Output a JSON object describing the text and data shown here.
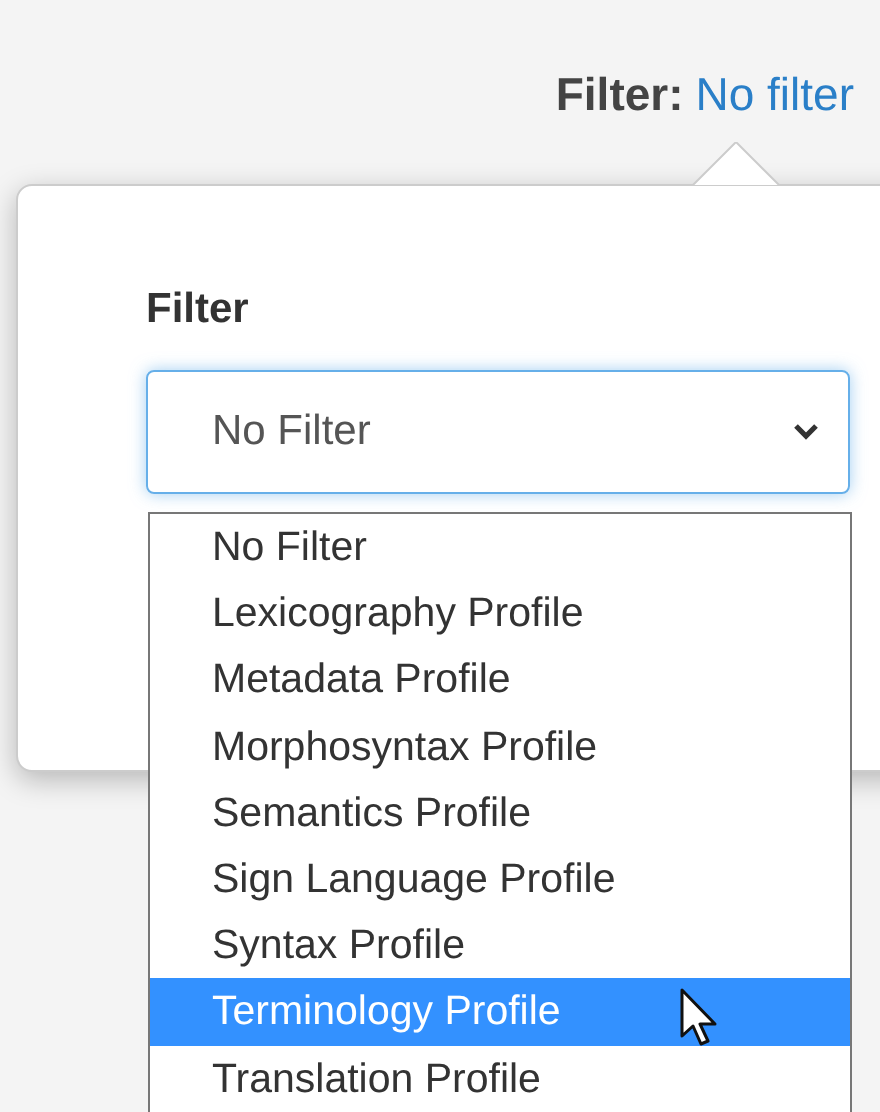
{
  "header": {
    "label": "Filter:",
    "value": "No filter"
  },
  "popover": {
    "label": "Filter",
    "select": {
      "value": "No Filter"
    },
    "options": [
      {
        "label": "No Filter",
        "selected": false
      },
      {
        "label": "Lexicography Profile",
        "selected": false
      },
      {
        "label": "Metadata Profile",
        "selected": false
      },
      {
        "label": "Morphosyntax Profile",
        "selected": false
      },
      {
        "label": "Semantics Profile",
        "selected": false
      },
      {
        "label": "Sign Language Profile",
        "selected": false
      },
      {
        "label": "Syntax Profile",
        "selected": false
      },
      {
        "label": "Terminology Profile",
        "selected": true
      },
      {
        "label": "Translation Profile",
        "selected": false
      }
    ]
  }
}
